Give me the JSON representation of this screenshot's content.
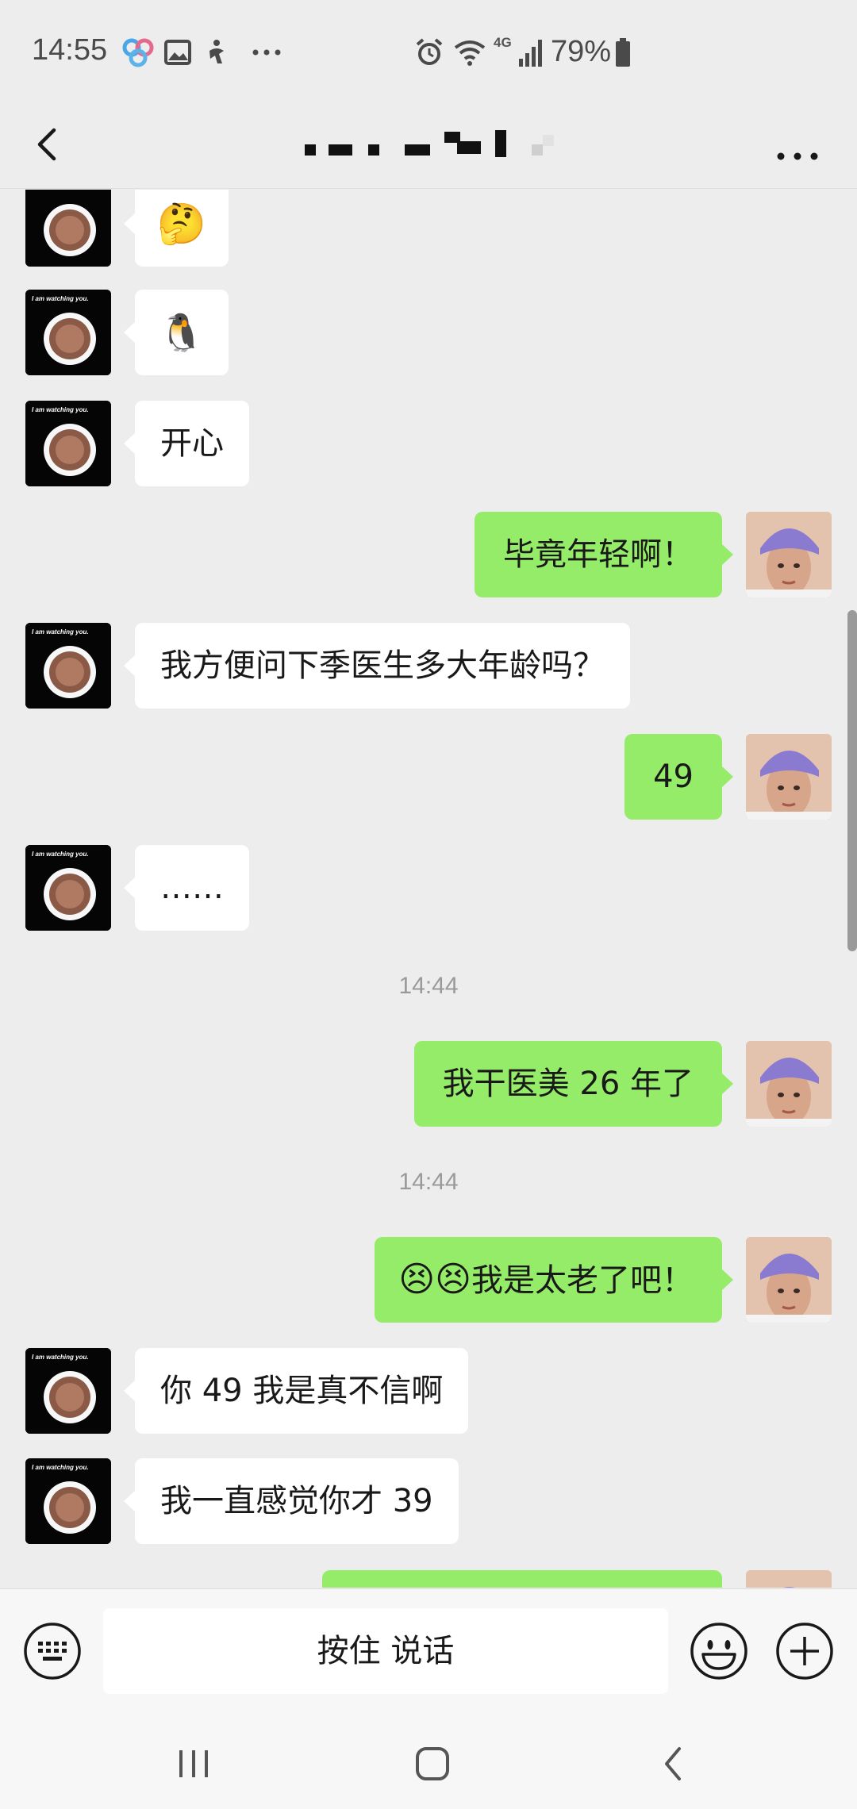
{
  "status_bar": {
    "time": "14:55",
    "network": "4G",
    "battery": "79%",
    "more_indicator": "···"
  },
  "nav": {
    "title_redacted": true
  },
  "messages": {
    "m1_sticker": "🤔",
    "m2_sticker": "🐧",
    "m3": "开心",
    "m4": "毕竟年轻啊！",
    "m5": "我方便问下季医生多大年龄吗？",
    "m6": "49",
    "m7": "……",
    "ts1": "14:44",
    "m8": "我干医美 26 年了",
    "ts2": "14:44",
    "m9_emojis": "😣😣",
    "m9_text": "我是太老了吧！",
    "m10": "你 49 我是真不信啊",
    "m11": "我一直感觉你才 39"
  },
  "avatar_caption": "I am watching you.",
  "input": {
    "hold_to_talk": "按住 说话"
  },
  "colors": {
    "self_bubble": "#95ec69",
    "other_bubble": "#ffffff",
    "background": "#ededed"
  },
  "icons": {
    "back": "chevron-left-icon",
    "more": "more-dots-icon",
    "keyboard": "keyboard-icon",
    "emoji": "smiley-icon",
    "plus": "plus-circle-icon",
    "recents": "recents-icon",
    "home": "home-icon",
    "sys_back": "system-back-icon"
  }
}
